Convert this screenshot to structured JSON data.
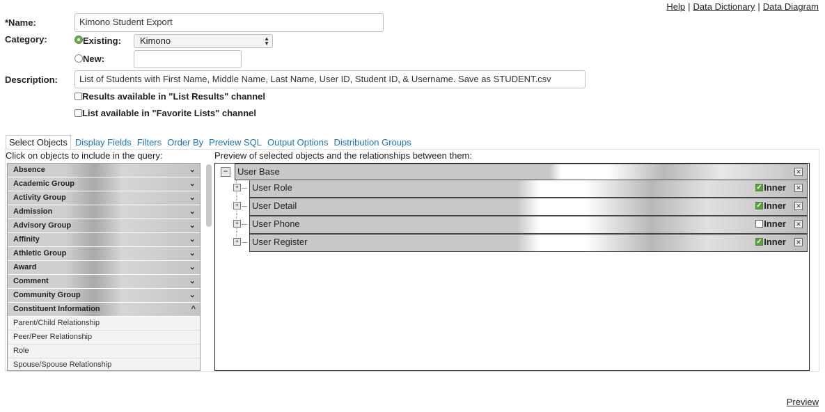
{
  "top_links": {
    "help": "Help",
    "data_dictionary": "Data Dictionary",
    "data_diagram": "Data Diagram",
    "separator": "|"
  },
  "form": {
    "name_label": "*Name:",
    "name_value": "Kimono Student Export",
    "category_label": "Category:",
    "existing_label": "Existing:",
    "existing_selected": "Kimono",
    "new_label": "New:",
    "new_value": "",
    "description_label": "Description:",
    "description_value": "List of Students with First Name, Middle Name, Last Name, User ID, Student ID, & Username. Save as STUDENT.csv",
    "results_checkbox_label": "Results available in \"List Results\" channel",
    "favorites_checkbox_label": "List available in \"Favorite Lists\" channel"
  },
  "tabs": [
    "Select Objects",
    "Display Fields",
    "Filters",
    "Order By",
    "Preview SQL",
    "Output Options",
    "Distribution Groups"
  ],
  "objects_panel": {
    "instruction": "Click on objects to include in the query:",
    "groups": [
      "Absence",
      "Academic Group",
      "Activity Group",
      "Admission",
      "Advisory Group",
      "Affinity",
      "Athletic Group",
      "Award",
      "Comment",
      "Community Group",
      "Constituent Information"
    ],
    "expanded_group": "Constituent Information",
    "sub_items": [
      "Parent/Child Relationship",
      "Peer/Peer Relationship",
      "Role",
      "Spouse/Spouse Relationship"
    ]
  },
  "preview_panel": {
    "instruction": "Preview of selected objects and the relationships between them:",
    "root": "User Base",
    "join_label": "Inner",
    "children": [
      {
        "name": "User Role",
        "inner": true
      },
      {
        "name": "User Detail",
        "inner": true
      },
      {
        "name": "User Phone",
        "inner": false
      },
      {
        "name": "User Register",
        "inner": true
      }
    ]
  },
  "footer": {
    "preview_link": "Preview"
  },
  "colors": {
    "link_blue": "#1a73b8",
    "radio_green": "#6aa84f",
    "check_green": "#5aa040"
  }
}
